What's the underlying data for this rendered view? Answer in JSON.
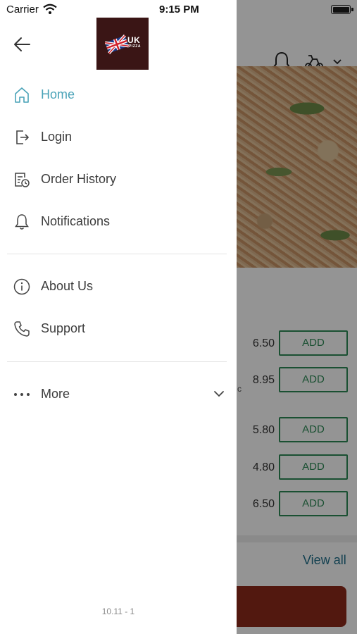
{
  "status_bar": {
    "carrier": "Carrier",
    "time": "9:15 PM"
  },
  "drawer": {
    "logo": {
      "text": "UK",
      "subtext": "PIZZA"
    },
    "menu_primary": [
      {
        "label": "Home",
        "icon": "home-icon",
        "active": true
      },
      {
        "label": "Login",
        "icon": "login-icon"
      },
      {
        "label": "Order History",
        "icon": "order-history-icon"
      },
      {
        "label": "Notifications",
        "icon": "bell-icon"
      }
    ],
    "menu_secondary": [
      {
        "label": "About Us",
        "icon": "info-icon"
      },
      {
        "label": "Support",
        "icon": "phone-icon"
      }
    ],
    "more": {
      "label": "More"
    },
    "version": "10.11 - 1"
  },
  "background": {
    "items": [
      {
        "price": "6.50",
        "button": "ADD"
      },
      {
        "price": "8.95",
        "button": "ADD"
      },
      {
        "price": "5.80",
        "button": "ADD"
      },
      {
        "price": "4.80",
        "button": "ADD"
      },
      {
        "price": "6.50",
        "button": "ADD"
      }
    ],
    "view_all": "View all"
  },
  "colors": {
    "accent": "#4aa3b8",
    "add_green": "#2e8b57",
    "logo_bg": "#3a1515"
  }
}
